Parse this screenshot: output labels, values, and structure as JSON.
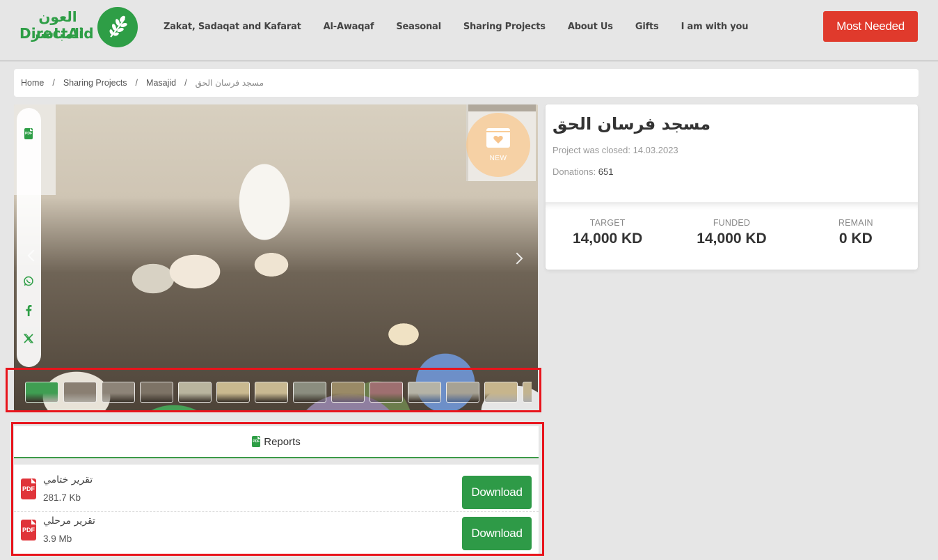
{
  "header": {
    "logo_ar": "العون المباشر",
    "logo_en": "DirectAid",
    "nav": [
      {
        "label": "Zakat, Sadaqat and Kafarat"
      },
      {
        "label": "Al-Awaqaf"
      },
      {
        "label": "Seasonal"
      },
      {
        "label": "Sharing Projects"
      },
      {
        "label": "About Us"
      },
      {
        "label": "Gifts"
      },
      {
        "label": "I am with you"
      }
    ],
    "cta_label": "Most Needed"
  },
  "breadcrumb": {
    "items": [
      {
        "label": "Home"
      },
      {
        "label": "Sharing Projects"
      },
      {
        "label": "Masajid"
      }
    ],
    "current": "مسجد فرسان الحق",
    "separator": "/"
  },
  "gallery": {
    "badge_label": "NEW",
    "share_icons": [
      "pdf-icon",
      "whatsapp-icon",
      "facebook-icon",
      "x-icon"
    ],
    "thumbnails": [
      {
        "color": "#3f9e52"
      },
      {
        "color": "#8a7f72"
      },
      {
        "color": "#8d8478"
      },
      {
        "color": "#7d7366"
      },
      {
        "color": "#b9b59e"
      },
      {
        "color": "#c9b98f"
      },
      {
        "color": "#c8b891"
      },
      {
        "color": "#8b8d7f"
      },
      {
        "color": "#9a8a66"
      },
      {
        "color": "#9e6f70"
      },
      {
        "color": "#b5b3a6"
      },
      {
        "color": "#a7a294"
      },
      {
        "color": "#c7b58c"
      },
      {
        "color": "#c2b38f"
      }
    ]
  },
  "project": {
    "title": "مسجد فرسان الحق",
    "closed_text": "Project was closed: 14.03.2023",
    "donations_label": "Donations: ",
    "donations_count": "651",
    "stats": [
      {
        "label": "TARGET",
        "value": "14,000 KD"
      },
      {
        "label": "FUNDED",
        "value": "14,000 KD"
      },
      {
        "label": "REMAIN",
        "value": "0 KD"
      }
    ]
  },
  "reports": {
    "title": "Reports",
    "items": [
      {
        "name": "تقرير ختامي",
        "size": "281.7 Kb",
        "button": "Download"
      },
      {
        "name": "تقرير مرحلي",
        "size": "3.9 Mb",
        "button": "Download"
      }
    ]
  },
  "colors": {
    "brand_green": "#2e9e46",
    "cta_red": "#e03a2c",
    "highlight_red": "#e8141c",
    "pdf_red": "#e0343a"
  }
}
